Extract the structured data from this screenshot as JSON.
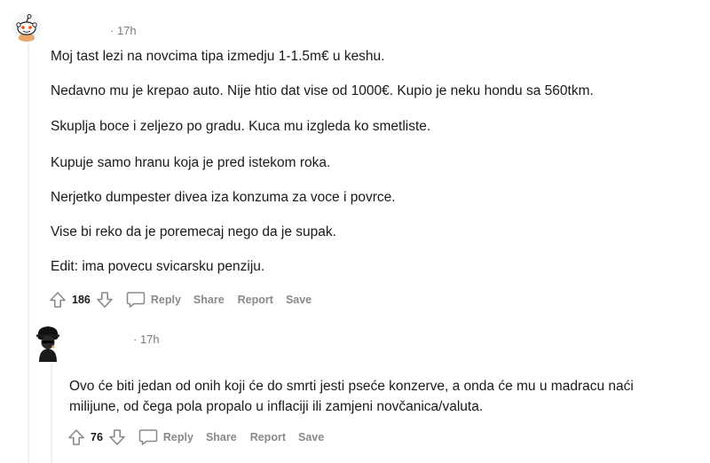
{
  "comments": [
    {
      "timestamp": "· 17h",
      "paragraphs": [
        "Moj tast lezi na novcima tipa izmedju 1-1.5m€ u keshu.",
        "Nedavno mu je krepao auto. Nije htio dat vise od 1000€. Kupio je neku hondu sa 560tkm.",
        "Skuplja boce i zeljezo po gradu. Kuca mu izgleda ko smetliste.",
        "Kupuje samo hranu koja je pred istekom roka.",
        "Nerjetko dumpester divea iza konzuma za voce i povrce.",
        "Vise bi reko da je poremecaj nego da je supak.",
        "Edit: ima povecu svicarsku penziju."
      ],
      "score": "186",
      "reply_label": "Reply",
      "share_label": "Share",
      "report_label": "Report",
      "save_label": "Save"
    },
    {
      "timestamp": "· 17h",
      "paragraphs": [
        "Ovo će biti jedan od onih koji će do smrti jesti pseće konzerve, a onda će mu u madracu naći",
        "milijune, od čega pola propalo u inflaciji ili zamjeni novčanica/valuta."
      ],
      "score": "76",
      "reply_label": "Reply",
      "share_label": "Share",
      "report_label": "Report",
      "save_label": "Save"
    }
  ],
  "icons": {
    "upvote": "upvote-arrow-icon",
    "downvote": "downvote-arrow-icon",
    "reply": "speech-bubble-icon",
    "avatar1": "snoo-avatar-icon",
    "avatar2": "dark-figure-avatar-icon"
  },
  "colors": {
    "action_text": "#878a8c",
    "timestamp": "#7c7c7c",
    "thread_line": "#edeff1",
    "body_text": "#1a1a1b"
  }
}
